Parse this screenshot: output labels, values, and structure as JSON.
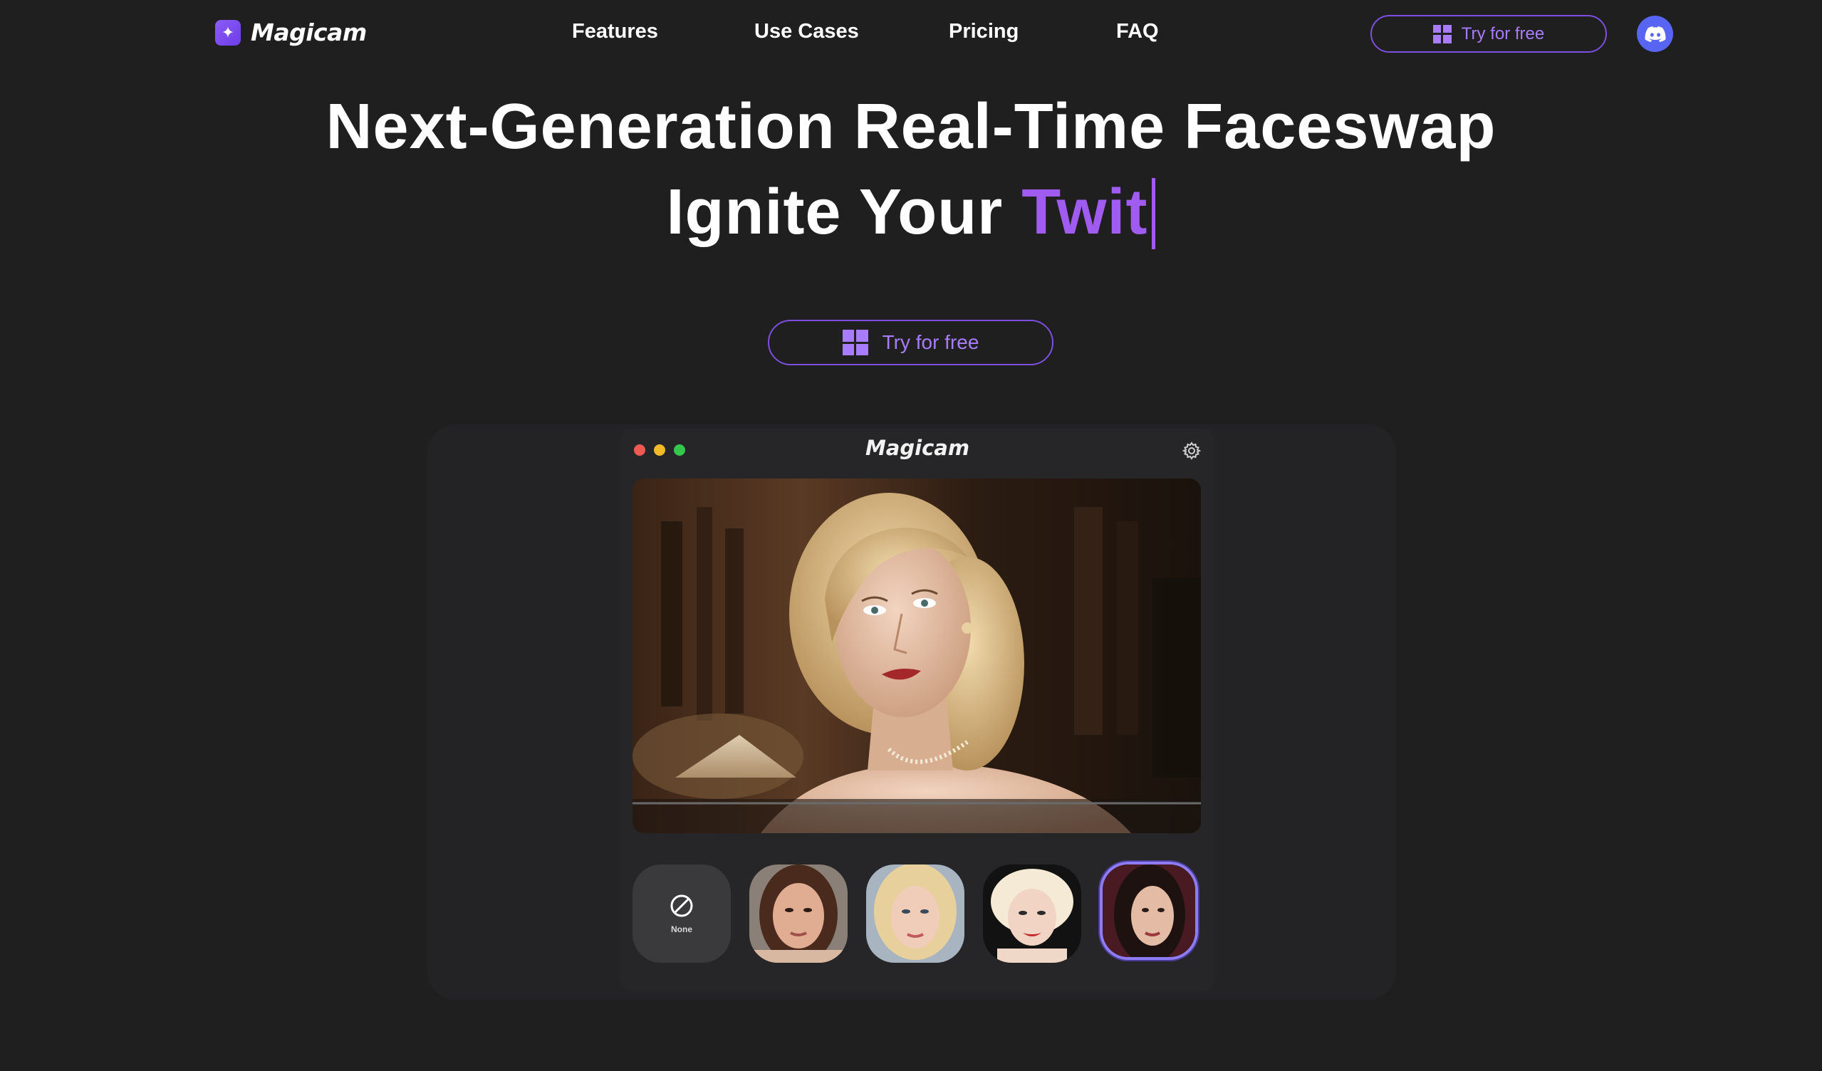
{
  "nav": {
    "logo_text": "Magicam",
    "links": [
      {
        "label": "Features"
      },
      {
        "label": "Use Cases"
      },
      {
        "label": "Pricing"
      },
      {
        "label": "FAQ"
      }
    ],
    "cta_label": "Try for free"
  },
  "hero": {
    "line1": "Next-Generation Real-Time Faceswap",
    "line2_prefix": "Ignite Your ",
    "line2_accent": "Twit",
    "cta_label": "Try for free"
  },
  "app": {
    "title": "Magicam",
    "thumbs": [
      {
        "name": "none",
        "label": "None"
      },
      {
        "name": "face-1"
      },
      {
        "name": "face-2"
      },
      {
        "name": "face-3"
      },
      {
        "name": "face-4",
        "selected": true
      }
    ]
  },
  "colors": {
    "background": "#1f1f20",
    "accent": "#a05cf0",
    "cta_border": "#7c4fe0",
    "discord": "#5865f2"
  },
  "icons": [
    "sparkle-icon",
    "windows-icon",
    "discord-icon",
    "gear-icon",
    "prohibited-icon"
  ]
}
